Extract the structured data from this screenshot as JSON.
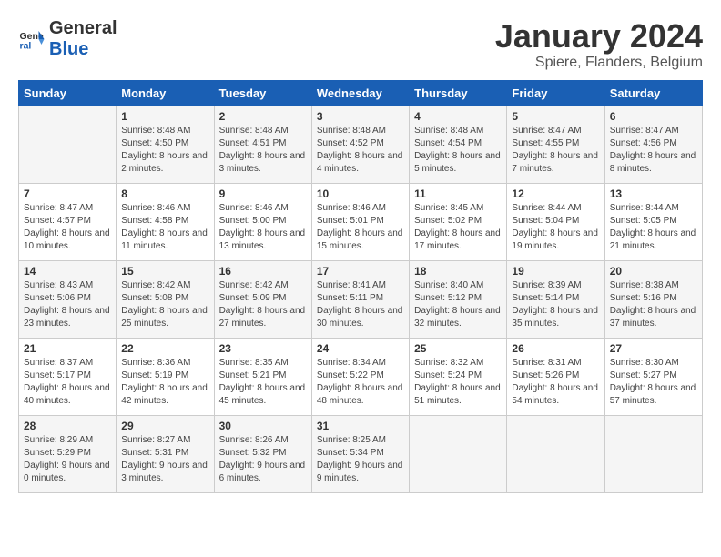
{
  "logo": {
    "general": "General",
    "blue": "Blue"
  },
  "title": "January 2024",
  "subtitle": "Spiere, Flanders, Belgium",
  "headers": [
    "Sunday",
    "Monday",
    "Tuesday",
    "Wednesday",
    "Thursday",
    "Friday",
    "Saturday"
  ],
  "weeks": [
    [
      {
        "day": "",
        "sunrise": "",
        "sunset": "",
        "daylight": ""
      },
      {
        "day": "1",
        "sunrise": "Sunrise: 8:48 AM",
        "sunset": "Sunset: 4:50 PM",
        "daylight": "Daylight: 8 hours and 2 minutes."
      },
      {
        "day": "2",
        "sunrise": "Sunrise: 8:48 AM",
        "sunset": "Sunset: 4:51 PM",
        "daylight": "Daylight: 8 hours and 3 minutes."
      },
      {
        "day": "3",
        "sunrise": "Sunrise: 8:48 AM",
        "sunset": "Sunset: 4:52 PM",
        "daylight": "Daylight: 8 hours and 4 minutes."
      },
      {
        "day": "4",
        "sunrise": "Sunrise: 8:48 AM",
        "sunset": "Sunset: 4:54 PM",
        "daylight": "Daylight: 8 hours and 5 minutes."
      },
      {
        "day": "5",
        "sunrise": "Sunrise: 8:47 AM",
        "sunset": "Sunset: 4:55 PM",
        "daylight": "Daylight: 8 hours and 7 minutes."
      },
      {
        "day": "6",
        "sunrise": "Sunrise: 8:47 AM",
        "sunset": "Sunset: 4:56 PM",
        "daylight": "Daylight: 8 hours and 8 minutes."
      }
    ],
    [
      {
        "day": "7",
        "sunrise": "Sunrise: 8:47 AM",
        "sunset": "Sunset: 4:57 PM",
        "daylight": "Daylight: 8 hours and 10 minutes."
      },
      {
        "day": "8",
        "sunrise": "Sunrise: 8:46 AM",
        "sunset": "Sunset: 4:58 PM",
        "daylight": "Daylight: 8 hours and 11 minutes."
      },
      {
        "day": "9",
        "sunrise": "Sunrise: 8:46 AM",
        "sunset": "Sunset: 5:00 PM",
        "daylight": "Daylight: 8 hours and 13 minutes."
      },
      {
        "day": "10",
        "sunrise": "Sunrise: 8:46 AM",
        "sunset": "Sunset: 5:01 PM",
        "daylight": "Daylight: 8 hours and 15 minutes."
      },
      {
        "day": "11",
        "sunrise": "Sunrise: 8:45 AM",
        "sunset": "Sunset: 5:02 PM",
        "daylight": "Daylight: 8 hours and 17 minutes."
      },
      {
        "day": "12",
        "sunrise": "Sunrise: 8:44 AM",
        "sunset": "Sunset: 5:04 PM",
        "daylight": "Daylight: 8 hours and 19 minutes."
      },
      {
        "day": "13",
        "sunrise": "Sunrise: 8:44 AM",
        "sunset": "Sunset: 5:05 PM",
        "daylight": "Daylight: 8 hours and 21 minutes."
      }
    ],
    [
      {
        "day": "14",
        "sunrise": "Sunrise: 8:43 AM",
        "sunset": "Sunset: 5:06 PM",
        "daylight": "Daylight: 8 hours and 23 minutes."
      },
      {
        "day": "15",
        "sunrise": "Sunrise: 8:42 AM",
        "sunset": "Sunset: 5:08 PM",
        "daylight": "Daylight: 8 hours and 25 minutes."
      },
      {
        "day": "16",
        "sunrise": "Sunrise: 8:42 AM",
        "sunset": "Sunset: 5:09 PM",
        "daylight": "Daylight: 8 hours and 27 minutes."
      },
      {
        "day": "17",
        "sunrise": "Sunrise: 8:41 AM",
        "sunset": "Sunset: 5:11 PM",
        "daylight": "Daylight: 8 hours and 30 minutes."
      },
      {
        "day": "18",
        "sunrise": "Sunrise: 8:40 AM",
        "sunset": "Sunset: 5:12 PM",
        "daylight": "Daylight: 8 hours and 32 minutes."
      },
      {
        "day": "19",
        "sunrise": "Sunrise: 8:39 AM",
        "sunset": "Sunset: 5:14 PM",
        "daylight": "Daylight: 8 hours and 35 minutes."
      },
      {
        "day": "20",
        "sunrise": "Sunrise: 8:38 AM",
        "sunset": "Sunset: 5:16 PM",
        "daylight": "Daylight: 8 hours and 37 minutes."
      }
    ],
    [
      {
        "day": "21",
        "sunrise": "Sunrise: 8:37 AM",
        "sunset": "Sunset: 5:17 PM",
        "daylight": "Daylight: 8 hours and 40 minutes."
      },
      {
        "day": "22",
        "sunrise": "Sunrise: 8:36 AM",
        "sunset": "Sunset: 5:19 PM",
        "daylight": "Daylight: 8 hours and 42 minutes."
      },
      {
        "day": "23",
        "sunrise": "Sunrise: 8:35 AM",
        "sunset": "Sunset: 5:21 PM",
        "daylight": "Daylight: 8 hours and 45 minutes."
      },
      {
        "day": "24",
        "sunrise": "Sunrise: 8:34 AM",
        "sunset": "Sunset: 5:22 PM",
        "daylight": "Daylight: 8 hours and 48 minutes."
      },
      {
        "day": "25",
        "sunrise": "Sunrise: 8:32 AM",
        "sunset": "Sunset: 5:24 PM",
        "daylight": "Daylight: 8 hours and 51 minutes."
      },
      {
        "day": "26",
        "sunrise": "Sunrise: 8:31 AM",
        "sunset": "Sunset: 5:26 PM",
        "daylight": "Daylight: 8 hours and 54 minutes."
      },
      {
        "day": "27",
        "sunrise": "Sunrise: 8:30 AM",
        "sunset": "Sunset: 5:27 PM",
        "daylight": "Daylight: 8 hours and 57 minutes."
      }
    ],
    [
      {
        "day": "28",
        "sunrise": "Sunrise: 8:29 AM",
        "sunset": "Sunset: 5:29 PM",
        "daylight": "Daylight: 9 hours and 0 minutes."
      },
      {
        "day": "29",
        "sunrise": "Sunrise: 8:27 AM",
        "sunset": "Sunset: 5:31 PM",
        "daylight": "Daylight: 9 hours and 3 minutes."
      },
      {
        "day": "30",
        "sunrise": "Sunrise: 8:26 AM",
        "sunset": "Sunset: 5:32 PM",
        "daylight": "Daylight: 9 hours and 6 minutes."
      },
      {
        "day": "31",
        "sunrise": "Sunrise: 8:25 AM",
        "sunset": "Sunset: 5:34 PM",
        "daylight": "Daylight: 9 hours and 9 minutes."
      },
      {
        "day": "",
        "sunrise": "",
        "sunset": "",
        "daylight": ""
      },
      {
        "day": "",
        "sunrise": "",
        "sunset": "",
        "daylight": ""
      },
      {
        "day": "",
        "sunrise": "",
        "sunset": "",
        "daylight": ""
      }
    ]
  ]
}
